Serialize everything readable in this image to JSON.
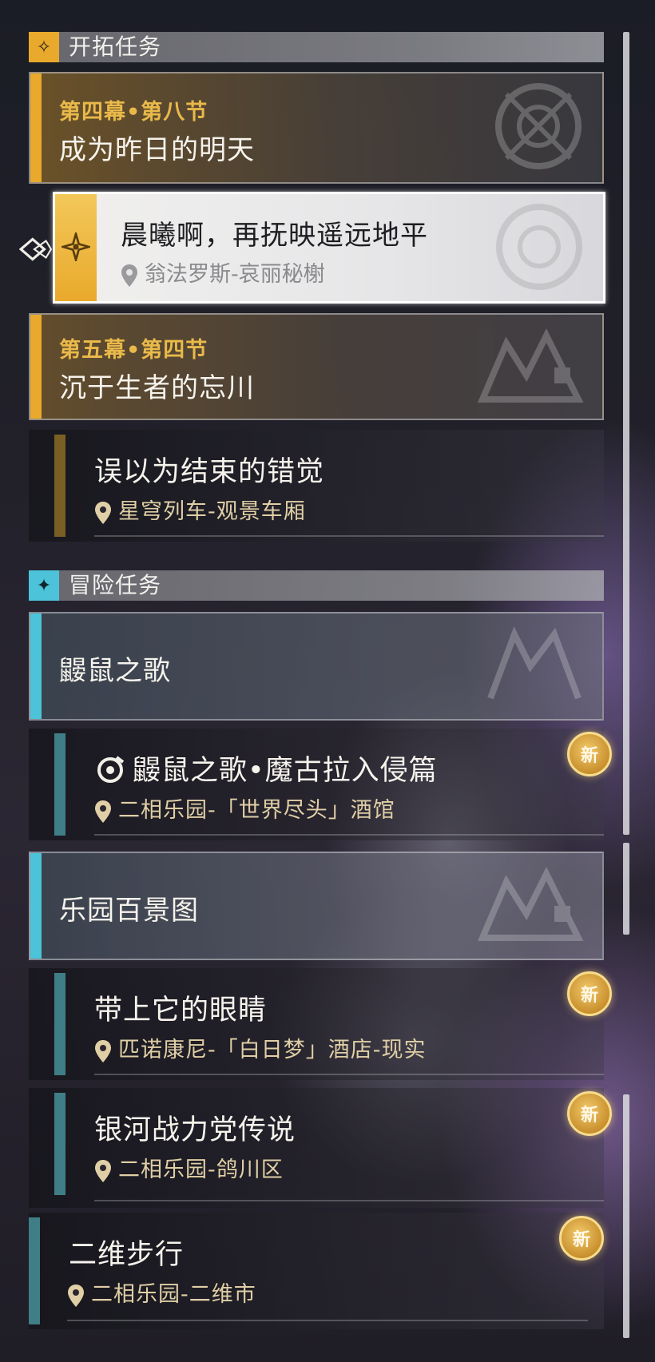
{
  "trailblaze": {
    "header": "开拓任务",
    "quests": [
      {
        "chapter": "第四幕•第八节",
        "title": "成为昨日的明天"
      },
      {
        "chapter": "第五幕•第四节",
        "title": "沉于生者的忘川"
      }
    ],
    "selected": {
      "title": "晨曦啊，再抚映遥远地平",
      "location": "翁法罗斯-哀丽秘榭"
    },
    "sub_quest": {
      "title": "误以为结束的错觉",
      "location": "星穹列车-观景车厢"
    }
  },
  "adventure": {
    "header": "冒险任务",
    "groups": [
      {
        "title": "鼹鼠之歌",
        "items": [
          {
            "title": "鼹鼠之歌•魔古拉入侵篇",
            "location": "二相乐园-「世界尽头」酒馆",
            "badge": "新"
          }
        ]
      },
      {
        "title": "乐园百景图",
        "items": [
          {
            "title": "带上它的眼睛",
            "location": "匹诺康尼-「白日梦」酒店-现实",
            "badge": "新"
          },
          {
            "title": "银河战力党传说",
            "location": "二相乐园-鸽川区",
            "badge": "新"
          }
        ]
      }
    ],
    "standalone": {
      "title": "二维步行",
      "location": "二相乐园-二维市",
      "badge": "新"
    }
  },
  "colors": {
    "gold": "#e9a92c",
    "gold_text": "#e9b94a",
    "cyan": "#4cc3d9",
    "teal_bar": "#3f7e86",
    "olive_bar": "#7a5f24"
  }
}
